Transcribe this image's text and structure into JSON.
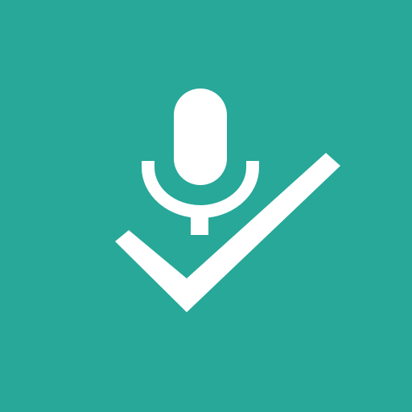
{
  "colors": {
    "background": "#27A899",
    "glyph": "#FFFFFF"
  },
  "icons": {
    "primary": "microphone-icon",
    "secondary": "checkmark-icon"
  }
}
